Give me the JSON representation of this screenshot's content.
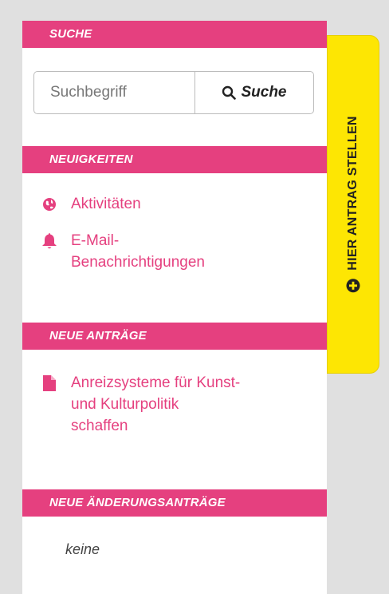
{
  "sections": {
    "search": {
      "header": "SUCHE",
      "input_placeholder": "Suchbegriff",
      "button_label": "Suche"
    },
    "news": {
      "header": "NEUIGKEITEN",
      "items": [
        {
          "label": "Aktivitäten",
          "icon": "globe-icon"
        },
        {
          "label_line1": "E-Mail-",
          "label_line2": "Benachrichtigungen",
          "icon": "bell-icon"
        }
      ]
    },
    "new_motions": {
      "header": "NEUE ANTRÄGE",
      "items": [
        {
          "line1": "Anreizsysteme für Kunst-",
          "line2": "und Kulturpolitik",
          "line3": "schaffen",
          "icon": "document-icon"
        }
      ]
    },
    "new_amendments": {
      "header": "NEUE ÄNDERUNGSANTRÄGE",
      "empty_text": "keine"
    }
  },
  "side_tab": {
    "label": "HIER ANTRAG STELLEN",
    "icon": "plus-circle-icon"
  },
  "colors": {
    "accent": "#e5407f",
    "tab": "#fde603",
    "background": "#e0e0e0"
  }
}
